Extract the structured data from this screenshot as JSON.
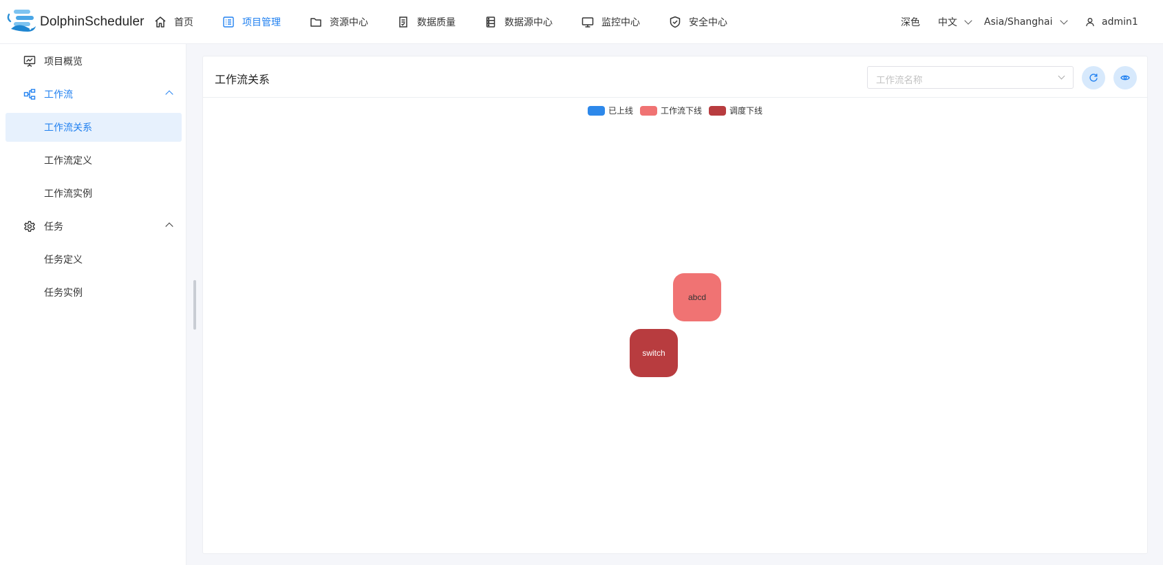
{
  "app": {
    "name": "DolphinScheduler"
  },
  "nav": [
    {
      "label": "首页",
      "icon": "home-icon",
      "active": false
    },
    {
      "label": "项目管理",
      "icon": "project-icon",
      "active": true
    },
    {
      "label": "资源中心",
      "icon": "folder-icon",
      "active": false
    },
    {
      "label": "数据质量",
      "icon": "document-icon",
      "active": false
    },
    {
      "label": "数据源中心",
      "icon": "database-icon",
      "active": false
    },
    {
      "label": "监控中心",
      "icon": "monitor-icon",
      "active": false
    },
    {
      "label": "安全中心",
      "icon": "shield-icon",
      "active": false
    }
  ],
  "header_right": {
    "theme": "深色",
    "language": "中文",
    "timezone": "Asia/Shanghai",
    "user": "admin1"
  },
  "sidebar": {
    "overview": "项目概览",
    "workflow_group": "工作流",
    "workflow_relation": "工作流关系",
    "workflow_definition": "工作流定义",
    "workflow_instance": "工作流实例",
    "task_group": "任务",
    "task_definition": "任务定义",
    "task_instance": "任务实例"
  },
  "card": {
    "title": "工作流关系",
    "select_placeholder": "工作流名称"
  },
  "legend": [
    {
      "label": "已上线",
      "color": "#2d88ea"
    },
    {
      "label": "工作流下线",
      "color": "#f07373"
    },
    {
      "label": "调度下线",
      "color": "#b83c3f"
    }
  ],
  "nodes": [
    {
      "label": "abcd",
      "status": "工作流下线",
      "color": "#f07373",
      "text_color": "#333333"
    },
    {
      "label": "switch",
      "status": "调度下线",
      "color": "#b83c3f",
      "text_color": "#ffffff"
    }
  ]
}
